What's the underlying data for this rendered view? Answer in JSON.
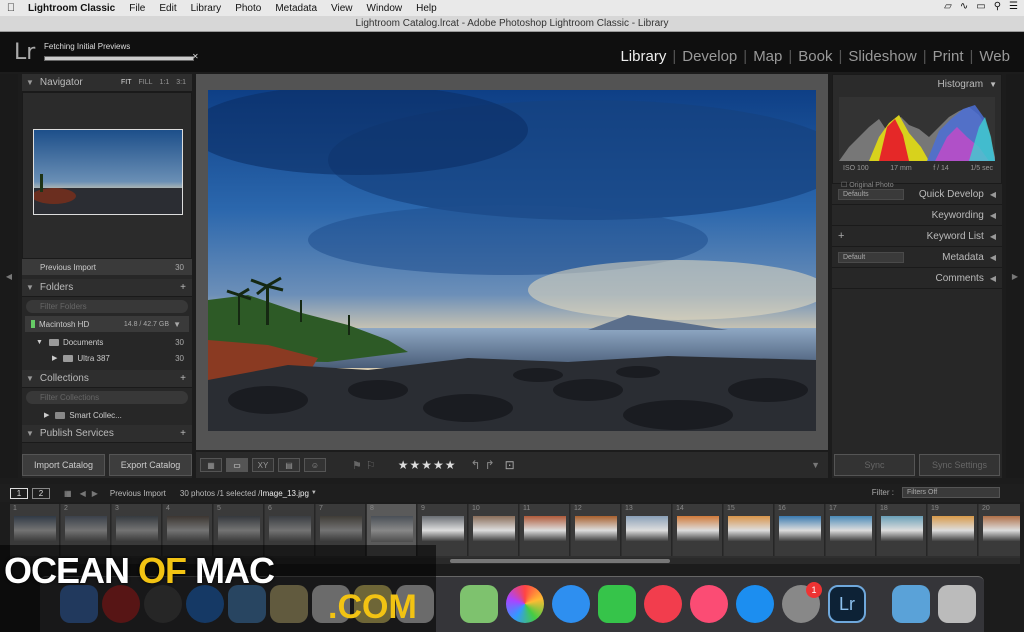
{
  "menubar": {
    "app": "Lightroom Classic",
    "items": [
      "File",
      "Edit",
      "Library",
      "Photo",
      "Metadata",
      "View",
      "Window",
      "Help"
    ]
  },
  "window": {
    "title": "Lightroom Catalog.lrcat - Adobe Photoshop Lightroom Classic - Library"
  },
  "top": {
    "logo": "Lr",
    "status": "Fetching Initial Previews",
    "modules": [
      "Library",
      "Develop",
      "Map",
      "Book",
      "Slideshow",
      "Print",
      "Web"
    ],
    "active_module": "Library"
  },
  "left": {
    "navigator": {
      "title": "Navigator",
      "options": [
        "FIT",
        "FILL",
        "1:1",
        "3:1"
      ]
    },
    "previous_import": {
      "label": "Previous Import",
      "count": "30"
    },
    "folders": {
      "title": "Folders",
      "filter_placeholder": "Filter Folders",
      "volume": {
        "name": "Macintosh HD",
        "size": "14.8 / 42.7 GB"
      },
      "items": [
        {
          "name": "Documents",
          "count": "30"
        },
        {
          "name": "Ultra 387",
          "count": "30"
        }
      ]
    },
    "collections": {
      "title": "Collections",
      "filter_placeholder": "Filter Collections",
      "items": [
        {
          "name": "Smart Collec..."
        }
      ]
    },
    "publish": {
      "title": "Publish Services"
    },
    "buttons": {
      "import": "Import Catalog",
      "export": "Export Catalog"
    }
  },
  "right": {
    "histogram": {
      "title": "Histogram",
      "exif": [
        "ISO 100",
        "17 mm",
        "f / 14",
        "1/5 sec"
      ],
      "original": "Original Photo"
    },
    "panels": [
      {
        "name": "Quick Develop",
        "select": "Defaults"
      },
      {
        "name": "Keywording"
      },
      {
        "name": "Keyword List",
        "plus": "+"
      },
      {
        "name": "Metadata",
        "select": "Default"
      },
      {
        "name": "Comments"
      }
    ],
    "buttons": {
      "sync": "Sync",
      "sync_settings": "Sync Settings"
    }
  },
  "toolbar": {
    "rating": "★★★★★",
    "views": [
      "grid",
      "loupe",
      "XY",
      "survey",
      "people"
    ]
  },
  "filmbar": {
    "pages": [
      "1",
      "2"
    ],
    "source": "Previous Import",
    "selection": "30 photos /1 selected /",
    "filename": "Image_13.jpg",
    "filter_label": "Filter :",
    "filter_value": "Filters Off"
  },
  "filmstrip": {
    "numbers": [
      "1",
      "2",
      "3",
      "4",
      "5",
      "6",
      "7",
      "8",
      "9",
      "10",
      "11",
      "12",
      "13",
      "14",
      "15",
      "16",
      "17",
      "18",
      "19",
      "20"
    ],
    "selected": "8"
  },
  "dock": {
    "badge": "1",
    "lr_label": "Lr"
  },
  "watermark": {
    "line1a": "OCEAN ",
    "line1b": "OF",
    "line1c": " MAC",
    "line2": ".COM"
  },
  "colors": {
    "accent": "#f2c313",
    "panel": "#272727",
    "center": "#535353"
  }
}
